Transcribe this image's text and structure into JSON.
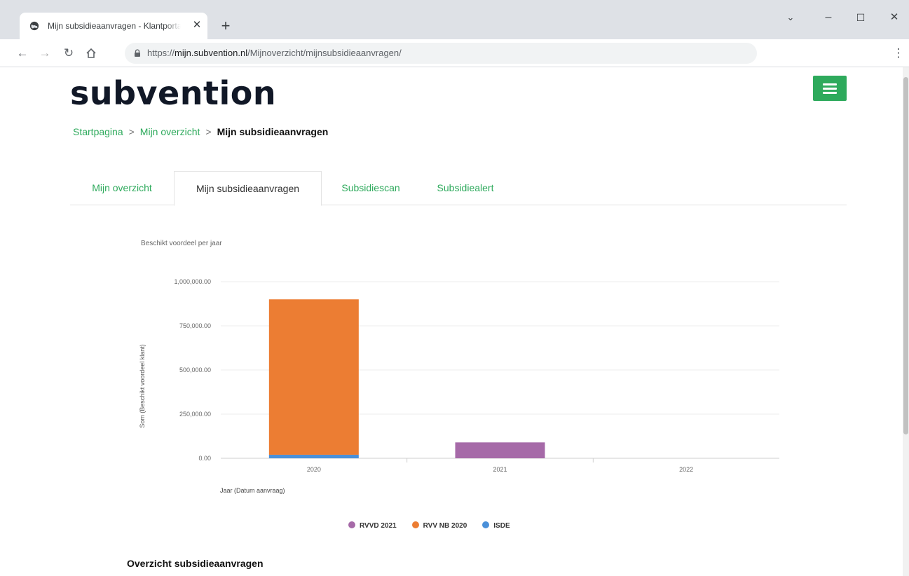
{
  "browser": {
    "tab_title": "Mijn subsidieaanvragen - Klantportaal",
    "tab_close": "✕",
    "new_tab": "+",
    "url_prefix": "https://",
    "url_host": "mijn.subvention.nl",
    "url_path": "/Mijnoverzicht/mijnsubsidieaanvragen/",
    "window_controls": {
      "chevron": "⌄",
      "minimize": "–",
      "maximize": "☐",
      "close": "✕"
    }
  },
  "site": {
    "logo": "subvention",
    "accent": "#2eaa5c"
  },
  "breadcrumb": {
    "items": [
      "Startpagina",
      "Mijn overzicht"
    ],
    "separator": ">",
    "current": "Mijn subsidieaanvragen"
  },
  "tabs": [
    {
      "label": "Mijn overzicht",
      "active": false
    },
    {
      "label": "Mijn subsidieaanvragen",
      "active": true
    },
    {
      "label": "Subsidiescan",
      "active": false
    },
    {
      "label": "Subsidiealert",
      "active": false
    }
  ],
  "chart_data": {
    "type": "bar",
    "stacked": true,
    "title": "Beschikt voordeel per jaar",
    "xlabel": "Jaar (Datum aanvraag)",
    "ylabel": "Som (Beschikt voordeel klant)",
    "categories": [
      "2020",
      "2021",
      "2022"
    ],
    "ylim": [
      0,
      1000000
    ],
    "yticks": [
      "0.00",
      "250,000.00",
      "500,000.00",
      "750,000.00",
      "1,000,000.00"
    ],
    "yticks_values": [
      0,
      250000,
      500000,
      750000,
      1000000
    ],
    "grid": true,
    "legend_position": "bottom",
    "series": [
      {
        "name": "ISDE",
        "color": "#4a90d9",
        "values": [
          20000,
          0,
          0
        ]
      },
      {
        "name": "RVV NB 2020",
        "color": "#ec7d33",
        "values": [
          880000,
          0,
          0
        ]
      },
      {
        "name": "RVVD 2021",
        "color": "#a66aa8",
        "values": [
          0,
          90000,
          0
        ]
      }
    ],
    "legend_order": [
      "RVVD 2021",
      "RVV NB 2020",
      "ISDE"
    ]
  },
  "section": {
    "title": "Overzicht subsidieaanvragen"
  }
}
